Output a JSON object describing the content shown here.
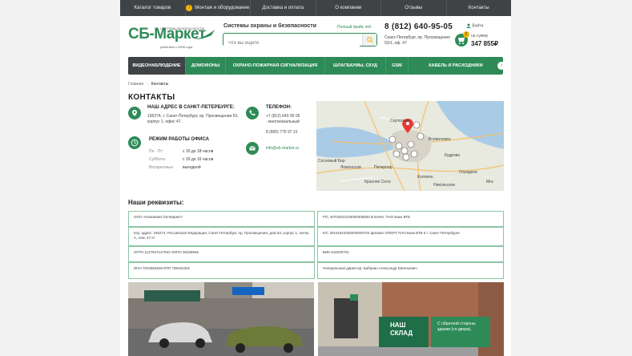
{
  "topnav": {
    "items": [
      "Каталог товаров",
      "Монтаж и оборудование",
      "Доставка и оплата",
      "О компании",
      "Отзывы",
      "Контакты"
    ],
    "badge": "!"
  },
  "header": {
    "logo_text": "СБ-Маркет",
    "logo_sub_top": "СИСТЕМЫ БЕЗОПАСНОСТИ",
    "logo_sub_bottom": "работаем с 2006 года",
    "tagline": "Системы охраны и безопасности",
    "price_link": "Полный прайс xml",
    "search_placeholder": "Что вы ищете",
    "phone": "8 (812) 640-95-05",
    "address": "Санкт-Петербург, пр. Просвещения 53/1, оф. 47",
    "login": "Войти",
    "cart_count": "2",
    "cart_label": "на сумму",
    "cart_sum": "347 855₽"
  },
  "mainnav": {
    "items": [
      "ВИДЕОНАБЛЮДЕНИЕ",
      "ДОМОФОНЫ",
      "ОХРАНО-ПОЖАРНАЯ СИГНАЛИЗАЦИЯ",
      "ШЛАГБАУМЫ, СКУД",
      "GSM",
      "КАБЕЛЬ И РАСХОДНИКИ"
    ],
    "more": "›"
  },
  "breadcrumb": {
    "home": "Главная",
    "sep": "›",
    "current": "Контакты"
  },
  "page_title": "КОНТАКТЫ",
  "contacts": {
    "address_title": "НАШ АДРЕС В САНКТ-ПЕТЕРБУРГЕ:",
    "address_text": "195274, г. Санкт-Петербург, пр. Просвещения 53, корпус 1, офис 47.",
    "phone_title": "ТЕЛЕФОН:",
    "phone_1": "+7 (812) 640 95 05",
    "phone_1_note": "- многоканальный",
    "phone_2": "8 (800) 775 97 31",
    "hours_title": "РЕЖИМ РАБОТЫ ОФИСА",
    "hours": [
      {
        "day": "Пн - Пт:",
        "time": "с 10 до 18 часов"
      },
      {
        "day": "Суббота:",
        "time": "с 10 до 16 часов"
      },
      {
        "day": "Воскресенье:",
        "time": "выходной"
      }
    ],
    "email": "info@sb-market.ru"
  },
  "map": {
    "labels": [
      "Сертолово",
      "Всеволожск",
      "Петергоф",
      "Красное Село",
      "Колпино",
      "Отрадное",
      "Мга",
      "Ломоносов",
      "Сосновый Бор",
      "Кудрово",
      "Никольское"
    ]
  },
  "requisites": {
    "title": "Наши реквизиты:",
    "left": [
      "ООО «Компания СБ-Маркет»",
      "Юр. адрес: 195274, Российская Федерация, Санкт-Петербург, пр. Просвещения, дом 53, корпус 1, литер А, пом. 47-Н",
      "ОГРН 1127847147922 ОКПО 38109946",
      "ИНН 7810862526 КПП 780401001"
    ],
    "right": [
      "Р/С 40702810100000005582 В БАНК: ПАО Банк ВТБ",
      "К/С 30101810200000000704 филиал ОПЕРУ ПАО Банк ВТБ в г. Санкт-Петербурге",
      "БИК 044030704",
      "Генеральный директор: Бабанин Александр Евгеньевич"
    ]
  },
  "warehouse": {
    "title_line1": "НАШ",
    "title_line2": "СКЛАД",
    "note": "С обратной стороны здания (со двора)."
  },
  "colors": {
    "brand": "#2e8b57",
    "dark": "#3f4346",
    "accent": "#f4b400"
  }
}
